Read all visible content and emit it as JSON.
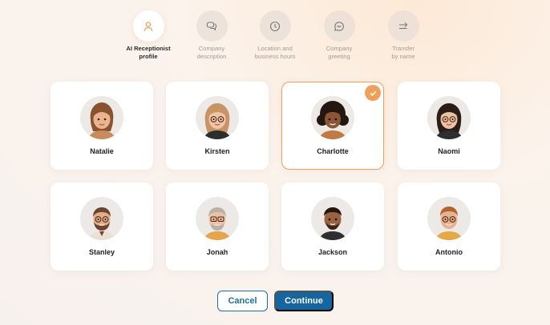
{
  "steps": [
    {
      "label": "AI Receptionist\nprofile",
      "icon": "person-icon",
      "active": true
    },
    {
      "label": "Company\ndescription",
      "icon": "chat-bubbles-icon",
      "active": false
    },
    {
      "label": "Location and\nbusiness hours",
      "icon": "clock-icon",
      "active": false
    },
    {
      "label": "Company\ngreeting",
      "icon": "chat-dots-icon",
      "active": false
    },
    {
      "label": "Transfer\nby name",
      "icon": "arrows-transfer-icon",
      "active": false
    }
  ],
  "profiles": [
    {
      "name": "Natalie",
      "selected": false
    },
    {
      "name": "Kirsten",
      "selected": false
    },
    {
      "name": "Charlotte",
      "selected": true
    },
    {
      "name": "Naomi",
      "selected": false
    },
    {
      "name": "Stanley",
      "selected": false
    },
    {
      "name": "Jonah",
      "selected": false
    },
    {
      "name": "Jackson",
      "selected": false
    },
    {
      "name": "Antonio",
      "selected": false
    }
  ],
  "actions": {
    "cancel_label": "Cancel",
    "continue_label": "Continue"
  },
  "colors": {
    "accent": "#f0a05a",
    "primary": "#1565a0"
  }
}
